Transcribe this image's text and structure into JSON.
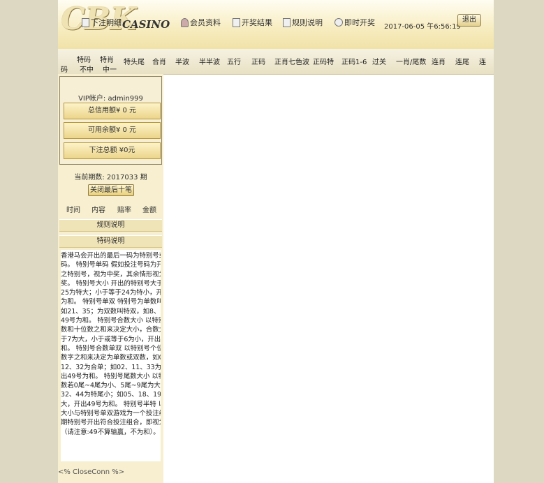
{
  "header": {
    "logo": "CBK",
    "logo_sub": "CASINO",
    "nav": [
      {
        "label": "下注明细",
        "icon": "document-icon"
      },
      {
        "label": "会员资料",
        "icon": "user-icon"
      },
      {
        "label": "开奖结果",
        "icon": "document-icon"
      },
      {
        "label": "规则说明",
        "icon": "document-icon"
      },
      {
        "label": "即时开奖",
        "icon": "clock-icon"
      }
    ],
    "datetime": "2017-06-05 午6:56:19",
    "logout": "退出"
  },
  "categories": [
    {
      "label": "特码",
      "sub": "",
      "left": false
    },
    {
      "label": "特肖",
      "sub": "",
      "left": false
    },
    {
      "label": "特头尾"
    },
    {
      "label": "合肖"
    },
    {
      "label": "半波"
    },
    {
      "label": "半半波"
    },
    {
      "label": "五行"
    },
    {
      "label": "正码"
    },
    {
      "label": "正肖七色波"
    },
    {
      "label": "正码特"
    },
    {
      "label": "正码1-6"
    },
    {
      "label": "过关"
    },
    {
      "label": "一肖/尾数"
    },
    {
      "label": "连肖"
    },
    {
      "label": "连尾"
    },
    {
      "label": "连"
    }
  ],
  "categories_second_row": {
    "left": "码",
    "a": "不中",
    "b": "中一"
  },
  "sidebar": {
    "vip_label": "VIP帐户: admin999",
    "credit_label": "总信用额¥ 0 元",
    "available_label": "可用余额¥ 0 元",
    "total_bet_label": "下注总额 ¥0元",
    "period_label": "当前期数: 2017033 期",
    "last10_button": "关闭最后十笔",
    "history_headers": [
      "时间",
      "内容",
      "赔率",
      "金额"
    ],
    "rules_bar": "规则说明",
    "tema_bar": "特码说明",
    "rules_lines": [
      "香港马会开出的最后一码为特别号或称特",
      "码。 特别号单码 假如投注号码为开奖号码",
      "之特别号，视为中奖，其余情形视为不中",
      "奖。 特别号大小 开出的特别号大于或等于",
      "25为特大；小于等于24为特小，开出49号",
      "为和。 特别号单双 特别号为单数叫特单，",
      "如21、35；为双数叫特双，如8、16；开出",
      "49号为和。 特别号合数大小 以特别号个位",
      "数和十位数之和来决定大小，合数大于或等",
      "于7为大，小于或等于6为小，开出49号为",
      "和。 特别号合数单双 以特别号个位和十位",
      "数字之和来决定为单数或双数，如01、",
      "12、32为合单；如02、11、33为合双，开",
      "出49号为和。 特别号尾数大小 以特别号尾",
      "数若0尾~4尾为小、5尾~9尾为大；如01、",
      "32、44为特尾小；如05、18、19为特尾",
      "大，开出49号为和。 特别号半特 以特别号",
      "大小与特别号单双游戏为一个投注组合；当",
      "期特别号开出符合投注组合，即视为中奖",
      "（请注意:49不算输赢，不为和）。"
    ],
    "close_conn": "<% CloseConn %>"
  }
}
